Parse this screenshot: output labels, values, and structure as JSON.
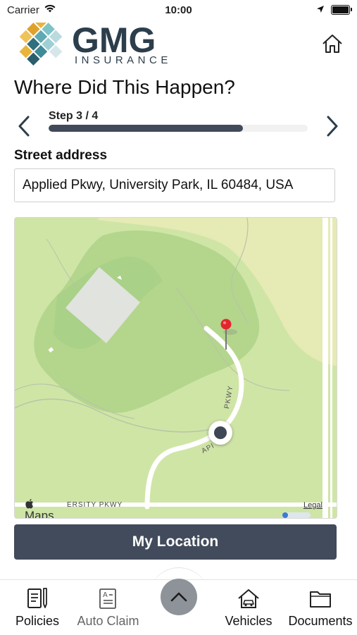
{
  "status_bar": {
    "carrier": "Carrier",
    "time": "10:00"
  },
  "brand": {
    "name": "GMG",
    "tagline": "INSURANCE"
  },
  "page": {
    "title": "Where Did This Happen?"
  },
  "stepper": {
    "label": "Step 3 / 4",
    "progress_fraction": 0.75
  },
  "address": {
    "label": "Street address",
    "value": "Applied Pkwy, University Park, IL 60484, USA"
  },
  "map": {
    "attribution": "Maps",
    "road_label": "ERSITY PKWY",
    "street_label_a": "PKWY",
    "street_label_b": "API",
    "legal": "Legal"
  },
  "actions": {
    "my_location": "My Location"
  },
  "tabs": [
    {
      "label": "Policies",
      "icon": "policies-icon"
    },
    {
      "label": "Auto Claim",
      "icon": "auto-claim-icon"
    },
    {
      "label": "Vehicles",
      "icon": "vehicles-icon"
    },
    {
      "label": "Documents",
      "icon": "documents-icon"
    }
  ],
  "colors": {
    "brand_dark": "#2c3e4c",
    "button": "#424b5b",
    "map_green": "#cfe5a6",
    "pin_red": "#e3262e"
  }
}
